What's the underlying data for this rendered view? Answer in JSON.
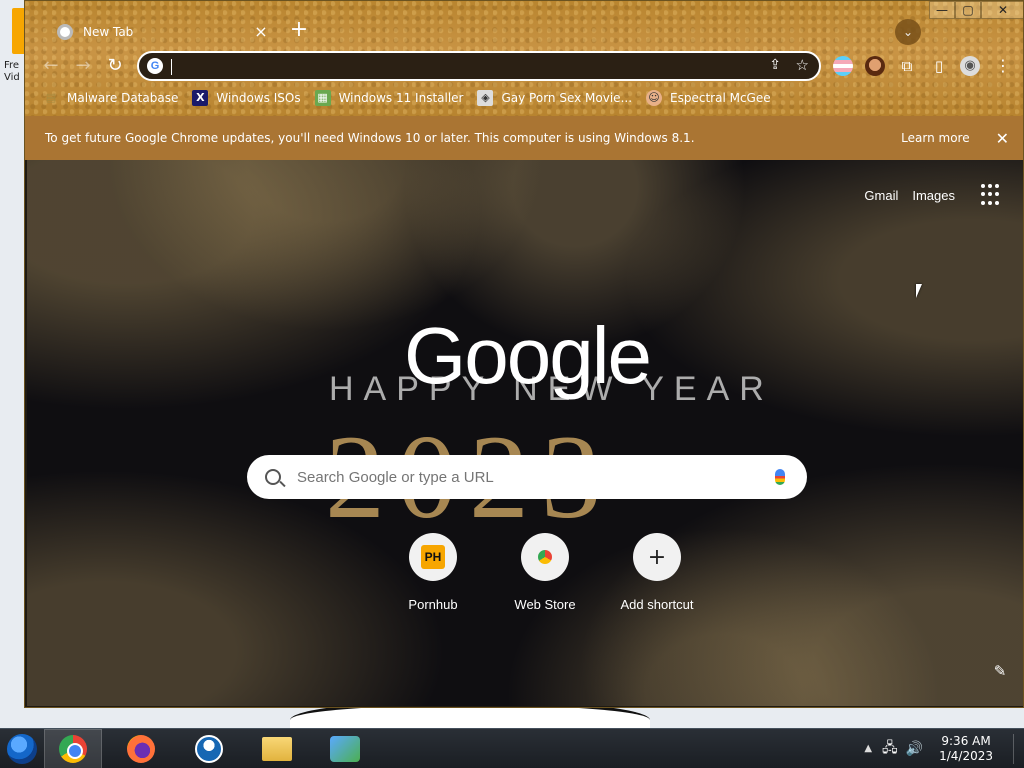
{
  "desktop": {
    "icon_label": "Fre Vid"
  },
  "window": {
    "minimize": "—",
    "maximize": "▢",
    "close": "✕"
  },
  "tab": {
    "title": "New Tab",
    "close": "×",
    "new_tab": "+",
    "tab_search": "⌄"
  },
  "toolbar": {
    "back": "←",
    "forward": "→",
    "reload": "↻",
    "omnibox_value": "",
    "share": "⇪",
    "star": "☆",
    "extensions": "⧉",
    "side_panel": "▯",
    "profile": "◉",
    "menu": "⋮"
  },
  "bookmarks": [
    {
      "label": "Malware Database",
      "icon": "folder-icon"
    },
    {
      "label": "Windows ISOs",
      "icon": "x-icon"
    },
    {
      "label": "Windows 11 Installer",
      "icon": "installer-icon"
    },
    {
      "label": "Gay Porn Sex Movie...",
      "icon": "movie-icon"
    },
    {
      "label": "Espectral McGee",
      "icon": "avatar-icon"
    }
  ],
  "infobar": {
    "message": "To get future Google Chrome updates, you'll need Windows 10 or later. This computer is using Windows 8.1.",
    "learn_more": "Learn more",
    "close": "✕"
  },
  "ntp": {
    "gmail": "Gmail",
    "images": "Images",
    "logo": "Google",
    "background_text_line1": "HAPPY NEW YEAR",
    "background_text_line2": "2023",
    "search_placeholder": "Search Google or type a URL",
    "shortcuts": [
      {
        "label": "Pornhub",
        "icon_text": "PH"
      },
      {
        "label": "Web Store",
        "icon_text": ""
      },
      {
        "label": "Add shortcut",
        "icon_text": "+"
      }
    ],
    "customize": "✎"
  },
  "taskbar": {
    "clock_time": "9:36 AM",
    "clock_date": "1/4/2023",
    "tray_arrow": "▲",
    "network": "🖧",
    "volume": "🔊"
  },
  "colors": {
    "infobar": "#aa7533",
    "frame": "#c29040",
    "ntp_background": "#0f0e11"
  }
}
